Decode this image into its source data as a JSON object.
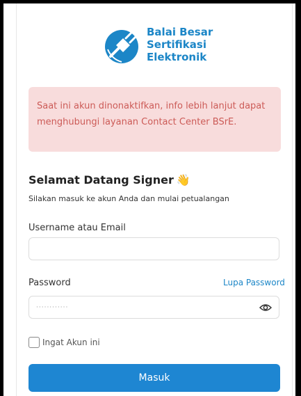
{
  "logo": {
    "line1": "Balai Besar",
    "line2": "Sertifikasi",
    "line3": "Elektronik"
  },
  "alert": {
    "message": "Saat ini akun dinonaktifkan, info lebih lanjut dapat menghubungi layanan Contact Center BSrE."
  },
  "welcome": {
    "title": "Selamat Datang Signer",
    "emoji": "👋",
    "subtitle": "Silakan masuk ke akun Anda dan mulai petualangan"
  },
  "form": {
    "username_label": "Username atau Email",
    "username_value": "",
    "password_label": "Password",
    "password_value": "············",
    "forgot_label": "Lupa Password",
    "remember_label": "Ingat Akun ini",
    "remember_checked": false,
    "submit_label": "Masuk"
  },
  "colors": {
    "brand": "#1c86c7",
    "button": "#1e86d2",
    "alert_bg": "#f8dcdc",
    "alert_text": "#cc5b57"
  },
  "icons": {
    "logo": "plug-icon",
    "password_toggle": "eye-icon"
  }
}
